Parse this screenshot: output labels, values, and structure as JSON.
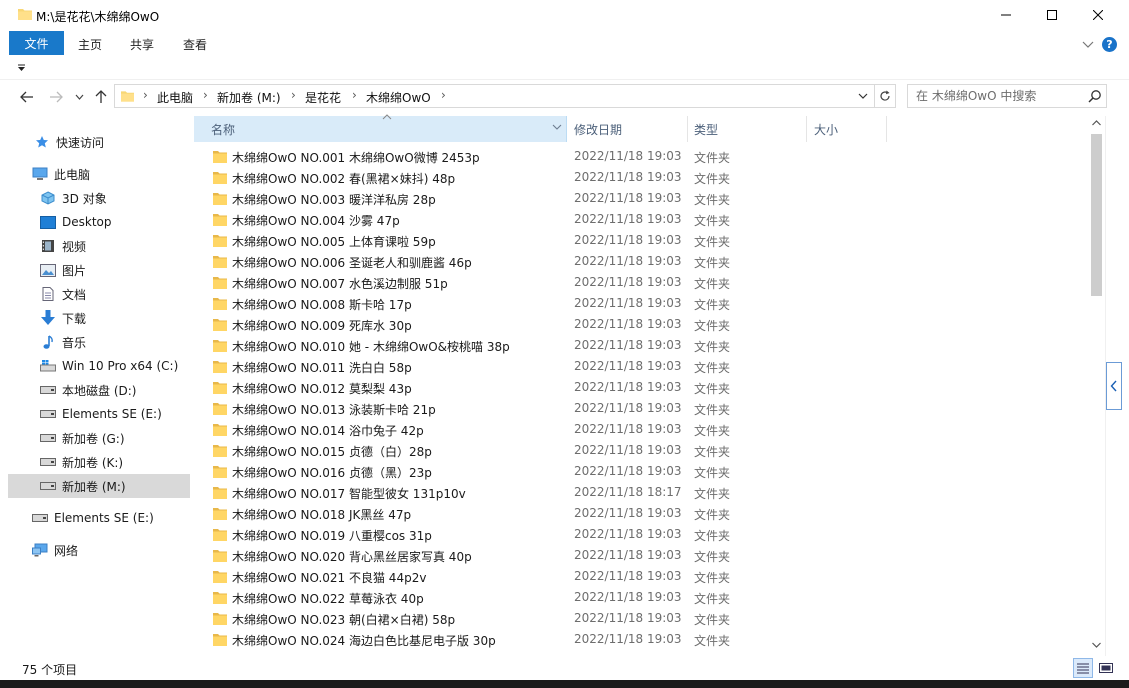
{
  "window": {
    "title": "M:\\是花花\\木绵绵OwO",
    "controls": {
      "minimize": "minimize-icon",
      "maximize": "maximize-icon",
      "close": "close-icon"
    }
  },
  "ribbon": {
    "tabs": [
      "文件",
      "主页",
      "共享",
      "查看"
    ],
    "active_tab": "文件",
    "accent": "#1979ca"
  },
  "address": {
    "crumbs": [
      "此电脑",
      "新加卷 (M:)",
      "是花花",
      "木绵绵OwO"
    ]
  },
  "search": {
    "placeholder": "在 木绵绵OwO 中搜索"
  },
  "sidebar": {
    "items": [
      {
        "label": "快速访问",
        "icon": "star-icon"
      },
      {
        "label": "此电脑",
        "icon": "computer-icon"
      },
      {
        "label": "3D 对象",
        "icon": "3d-objects-icon"
      },
      {
        "label": "Desktop",
        "icon": "desktop-icon"
      },
      {
        "label": "视频",
        "icon": "video-icon"
      },
      {
        "label": "图片",
        "icon": "pictures-icon"
      },
      {
        "label": "文档",
        "icon": "documents-icon"
      },
      {
        "label": "下载",
        "icon": "download-icon"
      },
      {
        "label": "音乐",
        "icon": "music-icon"
      },
      {
        "label": "Win 10 Pro x64 (C:)",
        "icon": "windows-drive-icon"
      },
      {
        "label": "本地磁盘 (D:)",
        "icon": "drive-icon"
      },
      {
        "label": "Elements SE (E:)",
        "icon": "drive-icon"
      },
      {
        "label": "新加卷 (G:)",
        "icon": "drive-icon"
      },
      {
        "label": "新加卷 (K:)",
        "icon": "drive-icon"
      },
      {
        "label": "新加卷 (M:)",
        "icon": "drive-icon",
        "selected": true
      },
      {
        "label": "Elements SE (E:)",
        "icon": "drive-icon"
      },
      {
        "label": "网络",
        "icon": "network-icon"
      }
    ]
  },
  "columns": {
    "name": "名称",
    "date": "修改日期",
    "type": "类型",
    "size": "大小"
  },
  "files": [
    {
      "name": "木绵绵OwO NO.001 木绵绵OwO微博 2453p",
      "date": "2022/11/18 19:03",
      "type": "文件夹"
    },
    {
      "name": "木绵绵OwO NO.002 春(黑裙×妹抖) 48p",
      "date": "2022/11/18 19:03",
      "type": "文件夹"
    },
    {
      "name": "木绵绵OwO NO.003 暖洋洋私房 28p",
      "date": "2022/11/18 19:03",
      "type": "文件夹"
    },
    {
      "name": "木绵绵OwO NO.004 沙雾 47p",
      "date": "2022/11/18 19:03",
      "type": "文件夹"
    },
    {
      "name": "木绵绵OwO NO.005 上体育课啦 59p",
      "date": "2022/11/18 19:03",
      "type": "文件夹"
    },
    {
      "name": "木绵绵OwO NO.006 圣诞老人和驯鹿酱 46p",
      "date": "2022/11/18 19:03",
      "type": "文件夹"
    },
    {
      "name": "木绵绵OwO NO.007 水色溪边制服 51p",
      "date": "2022/11/18 19:03",
      "type": "文件夹"
    },
    {
      "name": "木绵绵OwO NO.008 斯卡哈 17p",
      "date": "2022/11/18 19:03",
      "type": "文件夹"
    },
    {
      "name": "木绵绵OwO NO.009 死库水 30p",
      "date": "2022/11/18 19:03",
      "type": "文件夹"
    },
    {
      "name": "木绵绵OwO NO.010 她 - 木绵绵OwO&桉桃喵 38p",
      "date": "2022/11/18 19:03",
      "type": "文件夹"
    },
    {
      "name": "木绵绵OwO NO.011 洗白白 58p",
      "date": "2022/11/18 19:03",
      "type": "文件夹"
    },
    {
      "name": "木绵绵OwO NO.012 莫梨梨 43p",
      "date": "2022/11/18 19:03",
      "type": "文件夹"
    },
    {
      "name": "木绵绵OwO NO.013 泳装斯卡哈 21p",
      "date": "2022/11/18 19:03",
      "type": "文件夹"
    },
    {
      "name": "木绵绵OwO NO.014 浴巾兔子 42p",
      "date": "2022/11/18 19:03",
      "type": "文件夹"
    },
    {
      "name": "木绵绵OwO NO.015 贞德（白）28p",
      "date": "2022/11/18 19:03",
      "type": "文件夹"
    },
    {
      "name": "木绵绵OwO NO.016 贞德（黑）23p",
      "date": "2022/11/18 19:03",
      "type": "文件夹"
    },
    {
      "name": "木绵绵OwO NO.017 智能型彼女 131p10v",
      "date": "2022/11/18 18:17",
      "type": "文件夹"
    },
    {
      "name": "木绵绵OwO NO.018 JK黑丝 47p",
      "date": "2022/11/18 19:03",
      "type": "文件夹"
    },
    {
      "name": "木绵绵OwO NO.019 八重樱cos 31p",
      "date": "2022/11/18 19:03",
      "type": "文件夹"
    },
    {
      "name": "木绵绵OwO NO.020 背心黑丝居家写真 40p",
      "date": "2022/11/18 19:03",
      "type": "文件夹"
    },
    {
      "name": "木绵绵OwO NO.021 不良猫 44p2v",
      "date": "2022/11/18 19:03",
      "type": "文件夹"
    },
    {
      "name": "木绵绵OwO NO.022 草莓泳衣 40p",
      "date": "2022/11/18 19:03",
      "type": "文件夹"
    },
    {
      "name": "木绵绵OwO NO.023 朝(白裙×白裙) 58p",
      "date": "2022/11/18 19:03",
      "type": "文件夹"
    },
    {
      "name": "木绵绵OwO NO.024 海边白色比基尼电子版 30p",
      "date": "2022/11/18 19:03",
      "type": "文件夹"
    }
  ],
  "status": {
    "item_count": "75 个项目"
  }
}
